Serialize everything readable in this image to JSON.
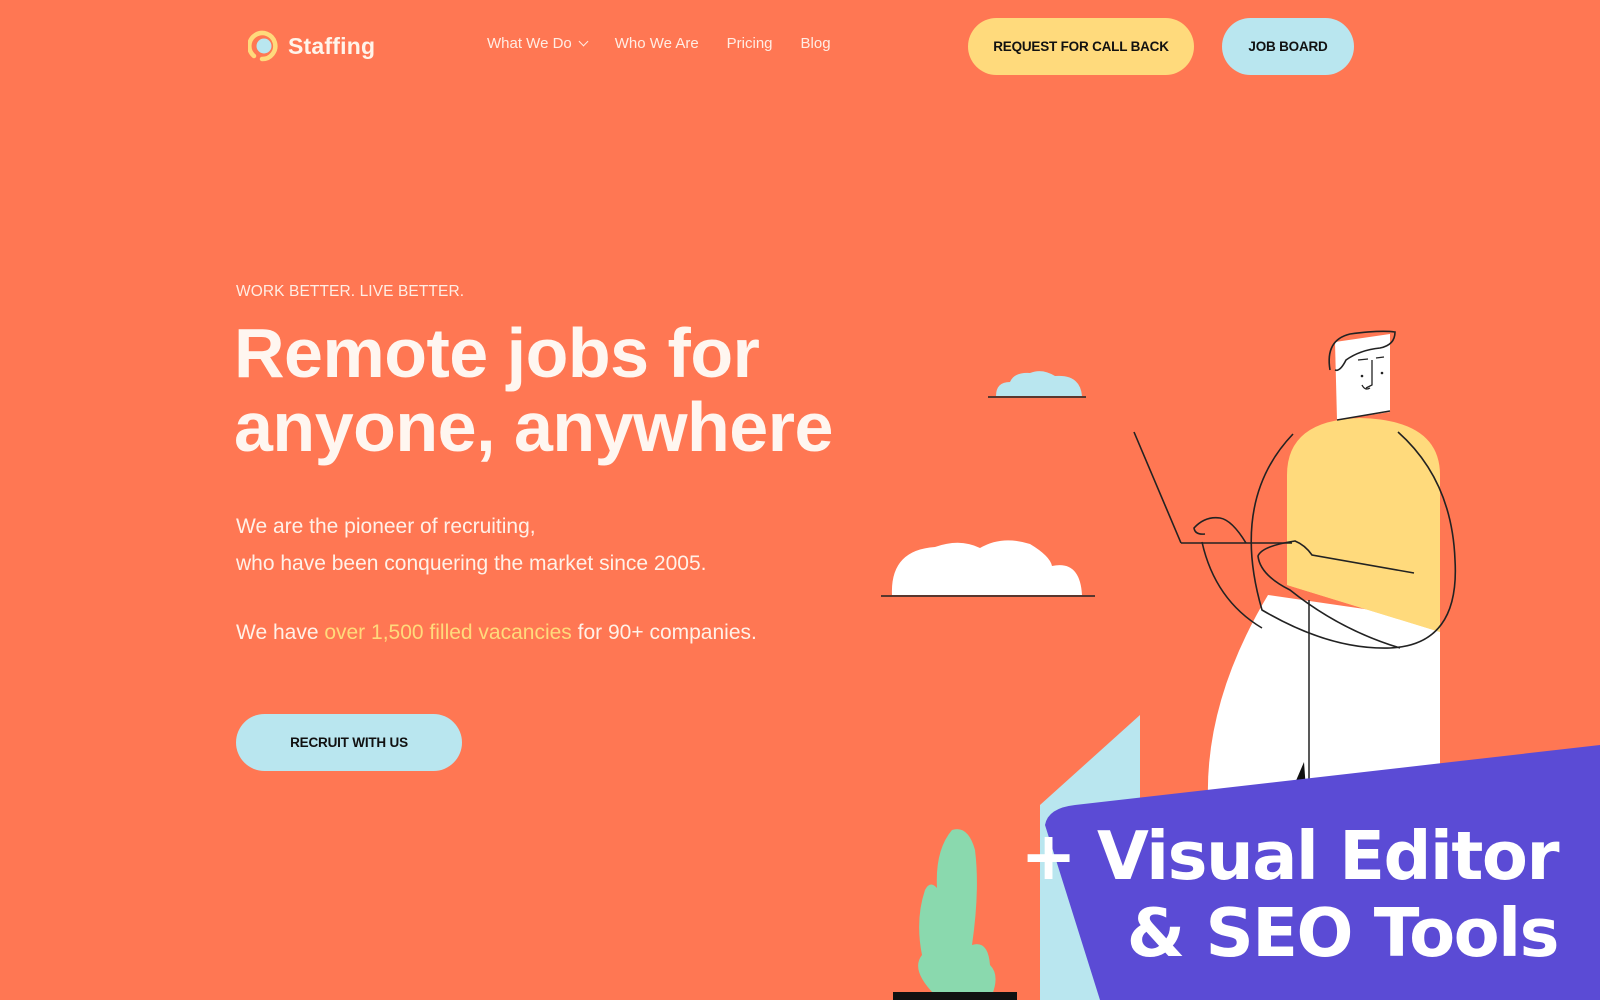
{
  "header": {
    "logo_text": "Staffing",
    "nav": [
      {
        "label": "What We Do",
        "has_dropdown": true
      },
      {
        "label": "Who We Are",
        "has_dropdown": false
      },
      {
        "label": "Pricing",
        "has_dropdown": false
      },
      {
        "label": "Blog",
        "has_dropdown": false
      }
    ],
    "callback_button": "REQUEST FOR CALL BACK",
    "jobboard_button": "JOB BOARD"
  },
  "hero": {
    "eyebrow": "WORK BETTER. LIVE BETTER.",
    "headline_line1": "Remote jobs for",
    "headline_line2": "anyone, anywhere",
    "desc_line1": "We are the pioneer of recruiting,",
    "desc_line2": "who have been conquering the market since 2005.",
    "stat_prefix": "We have ",
    "stat_highlight": "over 1,500 filled vacancies",
    "stat_suffix": " for 90+ companies.",
    "cta_button": "RECRUIT WITH US"
  },
  "promo": {
    "line1": "+ Visual Editor",
    "line2": "& SEO Tools"
  },
  "colors": {
    "background": "#FF7753",
    "accent_yellow": "#FFDA7C",
    "accent_blue": "#B9E6EF",
    "promo_purple": "#5B4BD5",
    "plant_green": "#8AD9AE"
  }
}
